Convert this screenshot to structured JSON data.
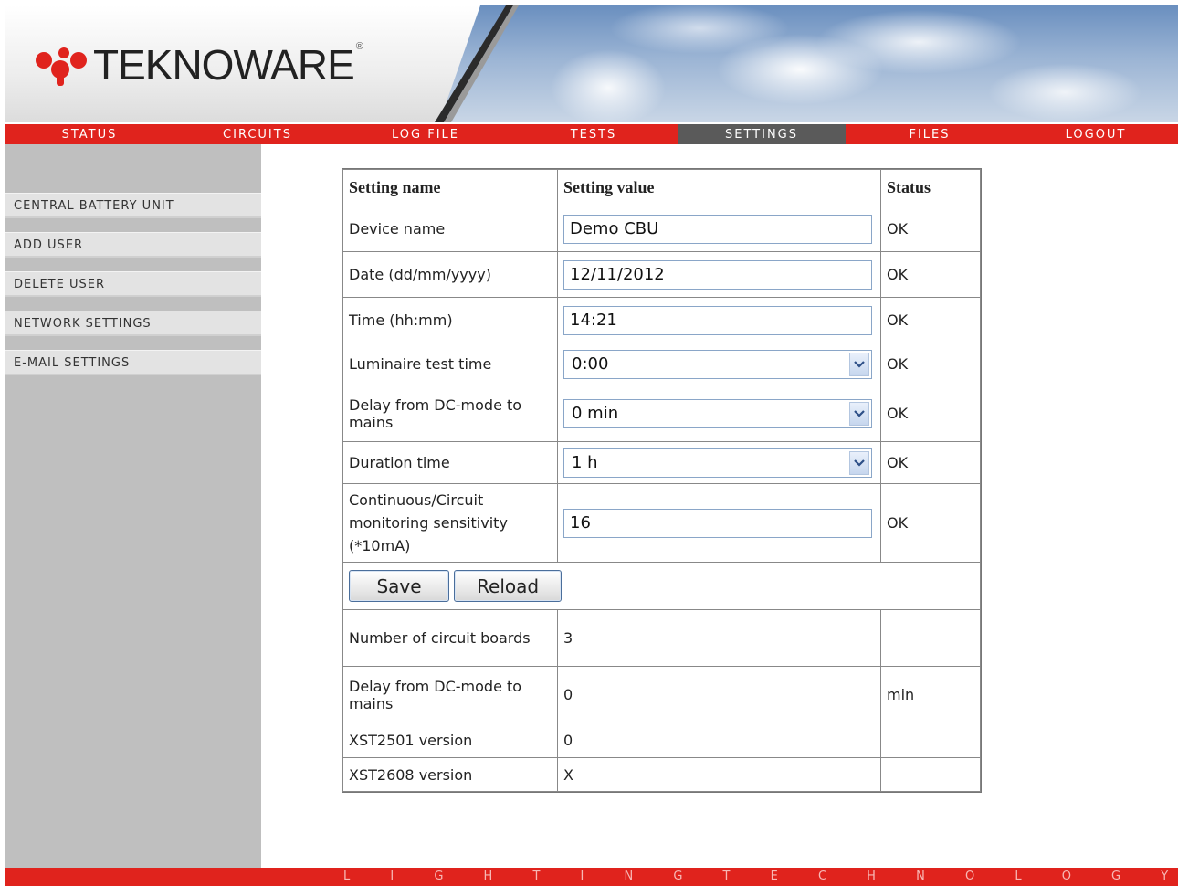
{
  "brand": {
    "name": "TEKNOWARE",
    "reg_mark": "®",
    "tagline": "L I G H T I N G   T E C H N O L O G Y"
  },
  "colors": {
    "brand_red": "#e0231d",
    "active_tab": "#5a5a5a",
    "header_text": "#aa1111",
    "ok": "#2c9b2c",
    "sidebar": "#bfbfbf"
  },
  "nav": {
    "active": "SETTINGS",
    "items": [
      {
        "label": "STATUS"
      },
      {
        "label": "CIRCUITS"
      },
      {
        "label": "LOG FILE"
      },
      {
        "label": "TESTS"
      },
      {
        "label": "SETTINGS"
      },
      {
        "label": "FILES"
      },
      {
        "label": "LOGOUT"
      }
    ]
  },
  "sidebar": {
    "items": [
      {
        "label": "CENTRAL BATTERY UNIT"
      },
      {
        "label": "ADD USER"
      },
      {
        "label": "DELETE USER"
      },
      {
        "label": "NETWORK SETTINGS"
      },
      {
        "label": "E-MAIL SETTINGS"
      }
    ]
  },
  "table": {
    "headers": {
      "name": "Setting name",
      "value": "Setting value",
      "status": "Status"
    },
    "rows": [
      {
        "name": "Device name",
        "value": "Demo CBU",
        "status": "OK"
      },
      {
        "name": "Date (dd/mm/yyyy)",
        "value": "12/11/2012",
        "status": "OK"
      },
      {
        "name": "Time (hh:mm)",
        "value": "14:21",
        "status": "OK"
      },
      {
        "name": "Luminaire test time",
        "value": "0:00",
        "status": "OK"
      },
      {
        "name": "Delay from DC-mode to mains",
        "value": "0 min",
        "status": "OK"
      },
      {
        "name": "Duration time",
        "value": "1 h",
        "status": "OK"
      },
      {
        "name": "Continuous/Circuit monitoring sensitivity (*10mA)",
        "value": "16",
        "status": "OK"
      }
    ],
    "buttons": {
      "save": "Save",
      "reload": "Reload"
    },
    "info": [
      {
        "name": "Number of circuit boards",
        "value": "3",
        "unit": ""
      },
      {
        "name": "Delay from DC-mode to mains",
        "value": "0",
        "unit": "min"
      },
      {
        "name": "XST2501 version",
        "value": "0",
        "unit": ""
      },
      {
        "name": "XST2608 version",
        "value": "X",
        "unit": ""
      }
    ]
  }
}
